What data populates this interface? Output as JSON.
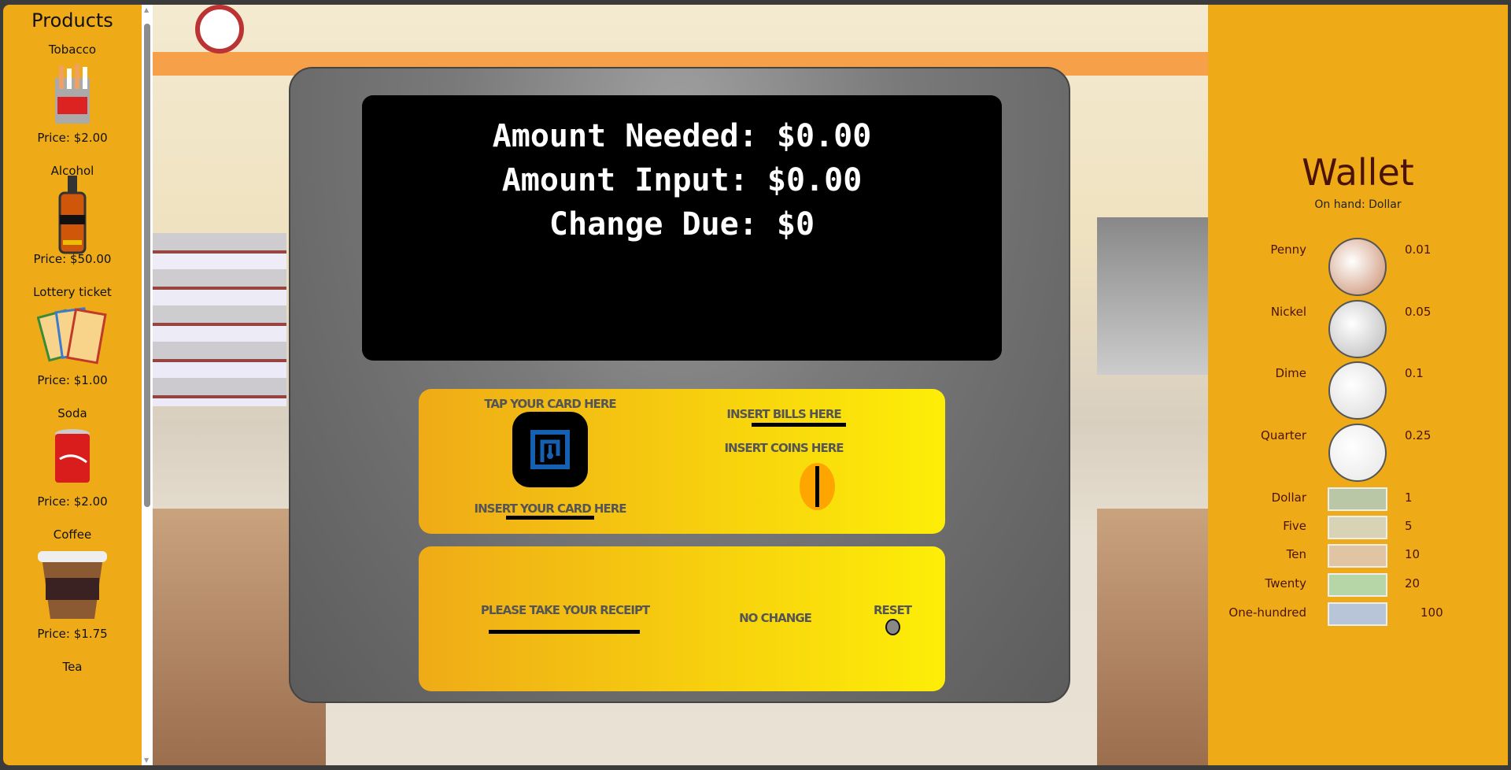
{
  "sidebar": {
    "title": "Products",
    "items": [
      {
        "name": "Tobacco",
        "price": "Price: $2.00",
        "icon": "cigarette-pack-icon"
      },
      {
        "name": "Alcohol",
        "price": "Price: $50.00",
        "icon": "bottle-icon"
      },
      {
        "name": "Lottery ticket",
        "price": "Price: $1.00",
        "icon": "lottery-ticket-icon"
      },
      {
        "name": "Soda",
        "price": "Price: $2.00",
        "icon": "soda-can-icon"
      },
      {
        "name": "Coffee",
        "price": "Price: $1.75",
        "icon": "coffee-cup-icon"
      },
      {
        "name": "Tea"
      }
    ]
  },
  "screen": {
    "line1": "Amount Needed: $0.00",
    "line2": "Amount Input: $0.00",
    "line3": "Change Due: $0"
  },
  "payment": {
    "tap": "TAP YOUR CARD HERE",
    "insert_card": "INSERT YOUR CARD HERE",
    "bills": "INSERT BILLS HERE",
    "coins": "INSERT COINS HERE"
  },
  "output": {
    "receipt": "PLEASE TAKE YOUR RECEIPT",
    "change": "NO CHANGE",
    "reset": "RESET"
  },
  "wallet": {
    "title": "Wallet",
    "on_hand": "On hand: Dollar",
    "items": [
      {
        "name": "Penny",
        "value": "0.01",
        "color": "#c98a6a"
      },
      {
        "name": "Nickel",
        "value": "0.05",
        "color": "#b8b8b8"
      },
      {
        "name": "Dime",
        "value": "0.1",
        "color": "#d8d8d8"
      },
      {
        "name": "Quarter",
        "value": "0.25",
        "color": "#e6e6e6"
      },
      {
        "name": "Dollar",
        "value": "1",
        "color": "#b9c7a6"
      },
      {
        "name": "Five",
        "value": "5",
        "color": "#d9d3b5"
      },
      {
        "name": "Ten",
        "value": "10",
        "color": "#e0c4a4"
      },
      {
        "name": "Twenty",
        "value": "20",
        "color": "#b6d6a8"
      },
      {
        "name": "One-hundred",
        "value": "100",
        "color": "#b8c4d8"
      }
    ]
  }
}
